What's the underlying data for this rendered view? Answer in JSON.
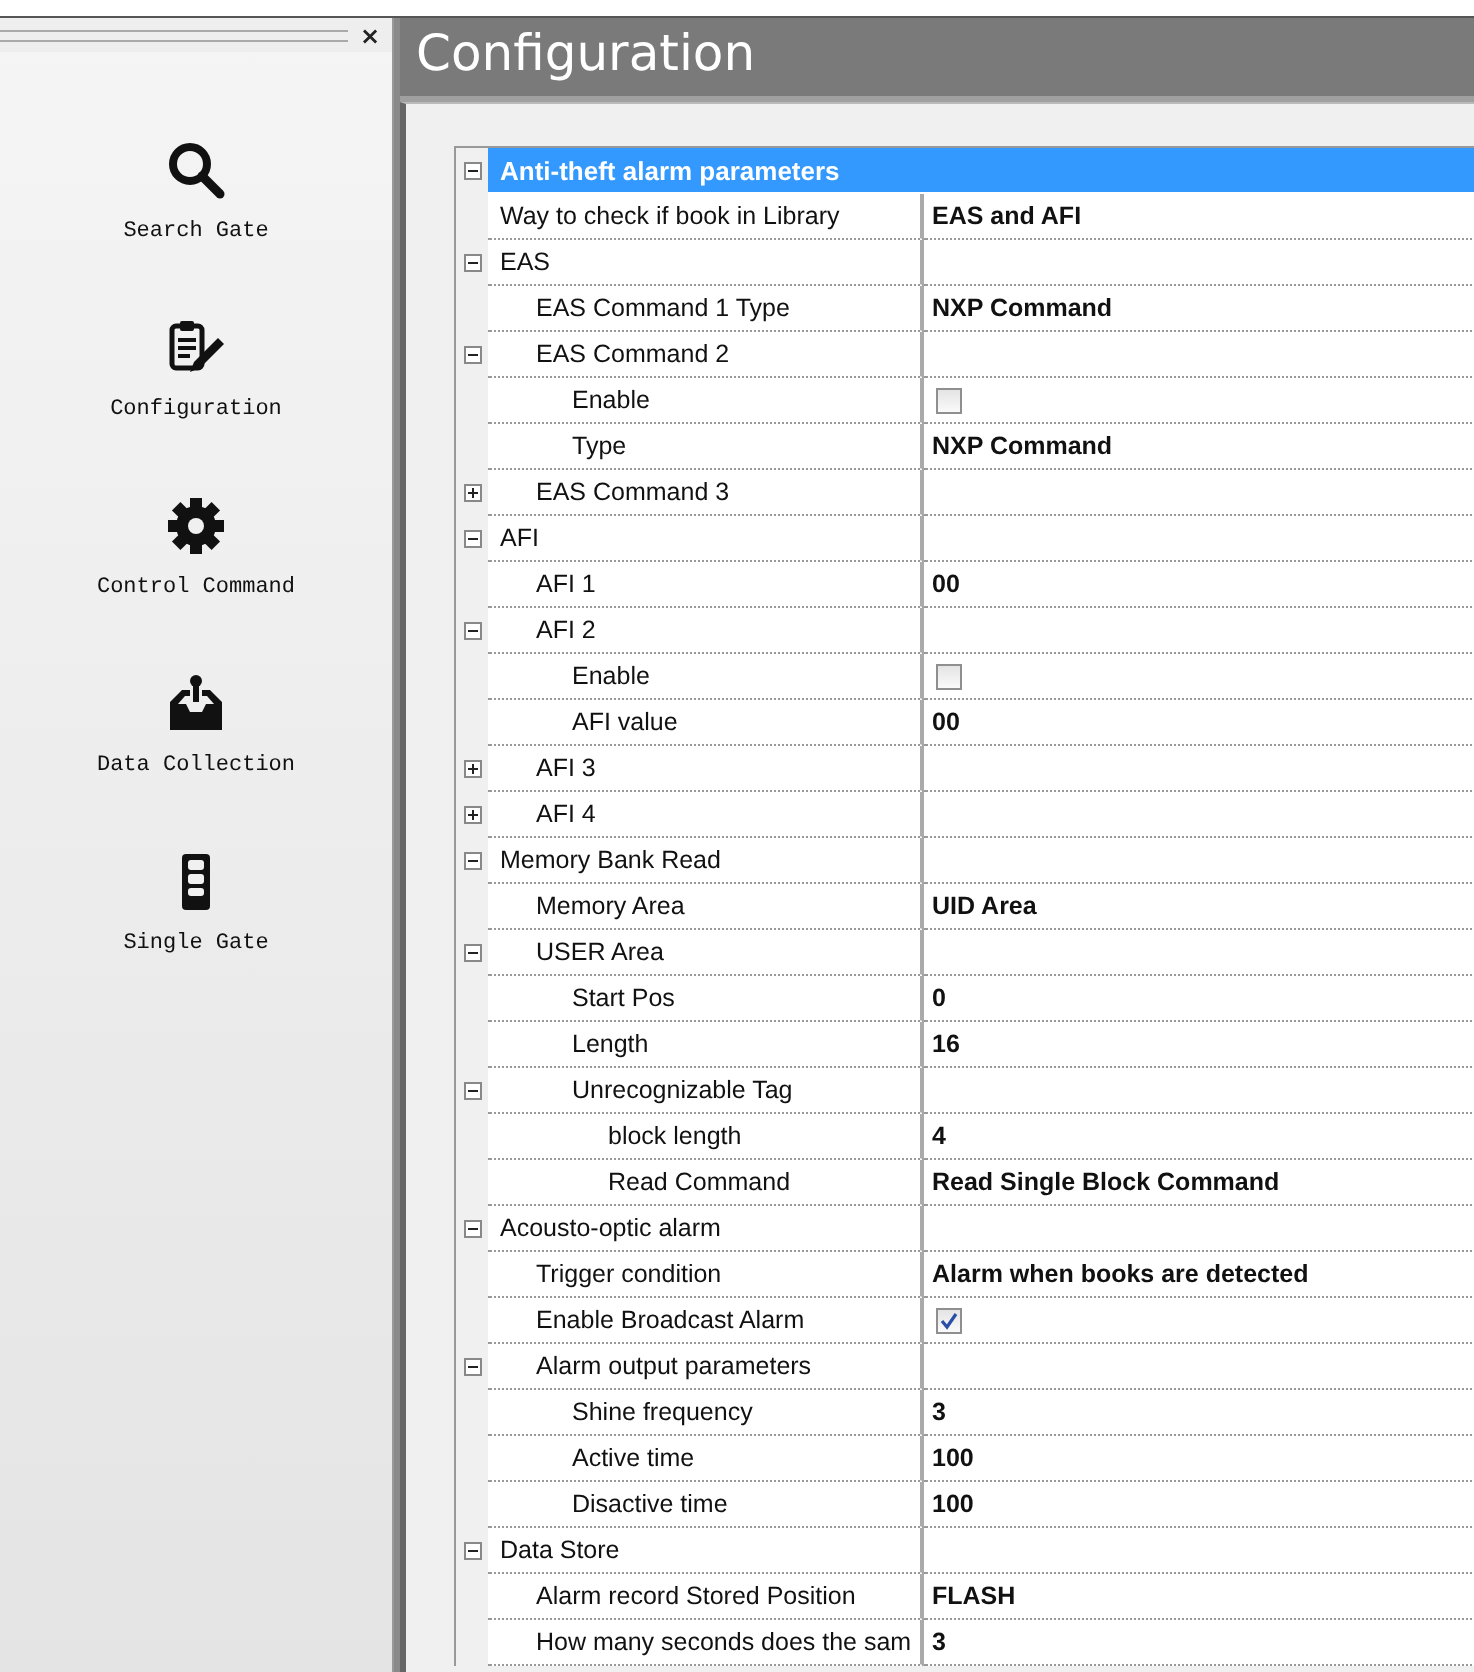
{
  "sidebar": {
    "close": "×",
    "items": [
      {
        "label": "Search Gate"
      },
      {
        "label": "Configuration"
      },
      {
        "label": "Control Command"
      },
      {
        "label": "Data Collection"
      },
      {
        "label": "Single Gate"
      }
    ]
  },
  "panel": {
    "title": "Configuration"
  },
  "grid": {
    "rows": [
      {
        "label": "Anti-theft alarm parameters",
        "kind": "category",
        "expanded": true,
        "selected": true,
        "children": [
          {
            "label": "Way to check if book in Library",
            "kind": "text",
            "value": "EAS and AFI",
            "selected": false
          },
          {
            "label": "EAS",
            "kind": "group",
            "expanded": true,
            "selected": false,
            "children": [
              {
                "label": "EAS Command 1 Type",
                "kind": "text",
                "value": "NXP Command",
                "selected": false
              },
              {
                "label": "EAS Command 2",
                "kind": "group",
                "expanded": true,
                "selected": false,
                "children": [
                  {
                    "label": "Enable",
                    "kind": "checkbox",
                    "checked": false,
                    "selected": false
                  },
                  {
                    "label": "Type",
                    "kind": "text",
                    "value": "NXP Command",
                    "selected": false
                  }
                ]
              },
              {
                "label": "EAS Command 3",
                "kind": "group",
                "expanded": false,
                "selected": false
              }
            ]
          },
          {
            "label": "AFI",
            "kind": "group",
            "expanded": true,
            "selected": false,
            "children": [
              {
                "label": "AFI 1",
                "kind": "text",
                "value": "00",
                "selected": false
              },
              {
                "label": "AFI 2",
                "kind": "group",
                "expanded": true,
                "selected": false,
                "children": [
                  {
                    "label": "Enable",
                    "kind": "checkbox",
                    "checked": false,
                    "selected": false
                  },
                  {
                    "label": "AFI value",
                    "kind": "text",
                    "value": "00",
                    "selected": false
                  }
                ]
              },
              {
                "label": "AFI 3",
                "kind": "group",
                "expanded": false,
                "selected": false
              },
              {
                "label": "AFI 4",
                "kind": "group",
                "expanded": false,
                "selected": false
              }
            ]
          },
          {
            "label": "Memory Bank Read",
            "kind": "group",
            "expanded": true,
            "selected": false,
            "children": [
              {
                "label": "Memory Area",
                "kind": "text",
                "value": "UID Area",
                "selected": false
              },
              {
                "label": "USER Area",
                "kind": "group",
                "expanded": true,
                "selected": false,
                "children": [
                  {
                    "label": "Start Pos",
                    "kind": "text",
                    "value": "0",
                    "selected": false
                  },
                  {
                    "label": "Length",
                    "kind": "text",
                    "value": "16",
                    "selected": false
                  },
                  {
                    "label": "Unrecognizable Tag",
                    "kind": "group",
                    "expanded": true,
                    "selected": false,
                    "children": [
                      {
                        "label": "block length",
                        "kind": "text",
                        "value": "4",
                        "selected": false
                      },
                      {
                        "label": "Read Command",
                        "kind": "text",
                        "value": "Read Single Block Command",
                        "selected": false
                      }
                    ]
                  }
                ]
              }
            ]
          },
          {
            "label": "Acousto-optic alarm",
            "kind": "group",
            "expanded": true,
            "selected": false,
            "children": [
              {
                "label": "Trigger condition",
                "kind": "text",
                "value": "Alarm when books are detected",
                "selected": false
              },
              {
                "label": "Enable Broadcast Alarm",
                "kind": "checkbox",
                "checked": true,
                "selected": false
              },
              {
                "label": "Alarm output parameters",
                "kind": "group",
                "expanded": true,
                "selected": false,
                "children": [
                  {
                    "label": "Shine frequency",
                    "kind": "text",
                    "value": "3",
                    "selected": false
                  },
                  {
                    "label": "Active time",
                    "kind": "text",
                    "value": "100",
                    "selected": false
                  },
                  {
                    "label": "Disactive time",
                    "kind": "text",
                    "value": "100",
                    "selected": false
                  }
                ]
              }
            ]
          },
          {
            "label": "Data Store",
            "kind": "group",
            "expanded": true,
            "selected": false,
            "children": [
              {
                "label": "Alarm record Stored Position",
                "kind": "text",
                "value": "FLASH",
                "selected": false
              },
              {
                "label": "How many seconds does the sam",
                "kind": "text",
                "value": "3",
                "selected": false
              }
            ]
          }
        ]
      }
    ]
  }
}
